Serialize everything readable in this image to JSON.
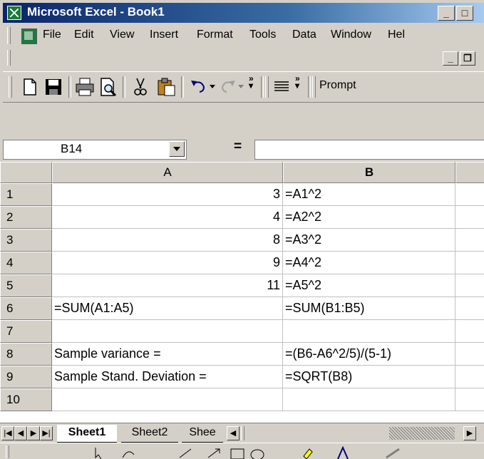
{
  "window": {
    "title": "Microsoft Excel - Book1"
  },
  "menubar": {
    "items": [
      {
        "label": "File",
        "name": "menu-file"
      },
      {
        "label": "Edit",
        "name": "menu-edit"
      },
      {
        "label": "View",
        "name": "menu-view"
      },
      {
        "label": "Insert",
        "name": "menu-insert"
      },
      {
        "label": "Format",
        "name": "menu-format"
      },
      {
        "label": "Tools",
        "name": "menu-tools"
      },
      {
        "label": "Data",
        "name": "menu-data"
      },
      {
        "label": "Window",
        "name": "menu-window"
      },
      {
        "label": "Hel",
        "name": "menu-help"
      }
    ]
  },
  "toolbar": {
    "buttons": [
      "new-icon",
      "save-icon",
      "print-icon",
      "print-preview-icon",
      "cut-icon",
      "paste-icon",
      "undo-icon",
      "redo-icon",
      "align-icon"
    ],
    "prompt_label": "Prompt"
  },
  "formula_bar": {
    "name_box": "B14",
    "equals": "=",
    "formula": ""
  },
  "grid": {
    "columns": [
      "A",
      "B"
    ],
    "active_column": "B",
    "rows": [
      {
        "num": "1",
        "a": "3",
        "b": "=A1^2"
      },
      {
        "num": "2",
        "a": "4",
        "b": "=A2^2"
      },
      {
        "num": "3",
        "a": "8",
        "b": "=A3^2"
      },
      {
        "num": "4",
        "a": "9",
        "b": "=A4^2"
      },
      {
        "num": "5",
        "a": "11",
        "b": "=A5^2"
      },
      {
        "num": "6",
        "a": "=SUM(A1:A5)",
        "b": "=SUM(B1:B5)"
      },
      {
        "num": "7",
        "a": "",
        "b": ""
      },
      {
        "num": "8",
        "a": "Sample variance =",
        "b": "=(B6-A6^2/5)/(5-1)"
      },
      {
        "num": "9",
        "a": "Sample Stand. Deviation =",
        "b": "=SQRT(B8)"
      },
      {
        "num": "10",
        "a": "",
        "b": ""
      }
    ]
  },
  "sheets": {
    "tabs": [
      "Sheet1",
      "Sheet2",
      "Shee"
    ],
    "active": "Sheet1"
  },
  "colors": {
    "titlebar": "#0a246a",
    "chrome": "#d4d0c8",
    "gridline": "#c0c0c0"
  }
}
